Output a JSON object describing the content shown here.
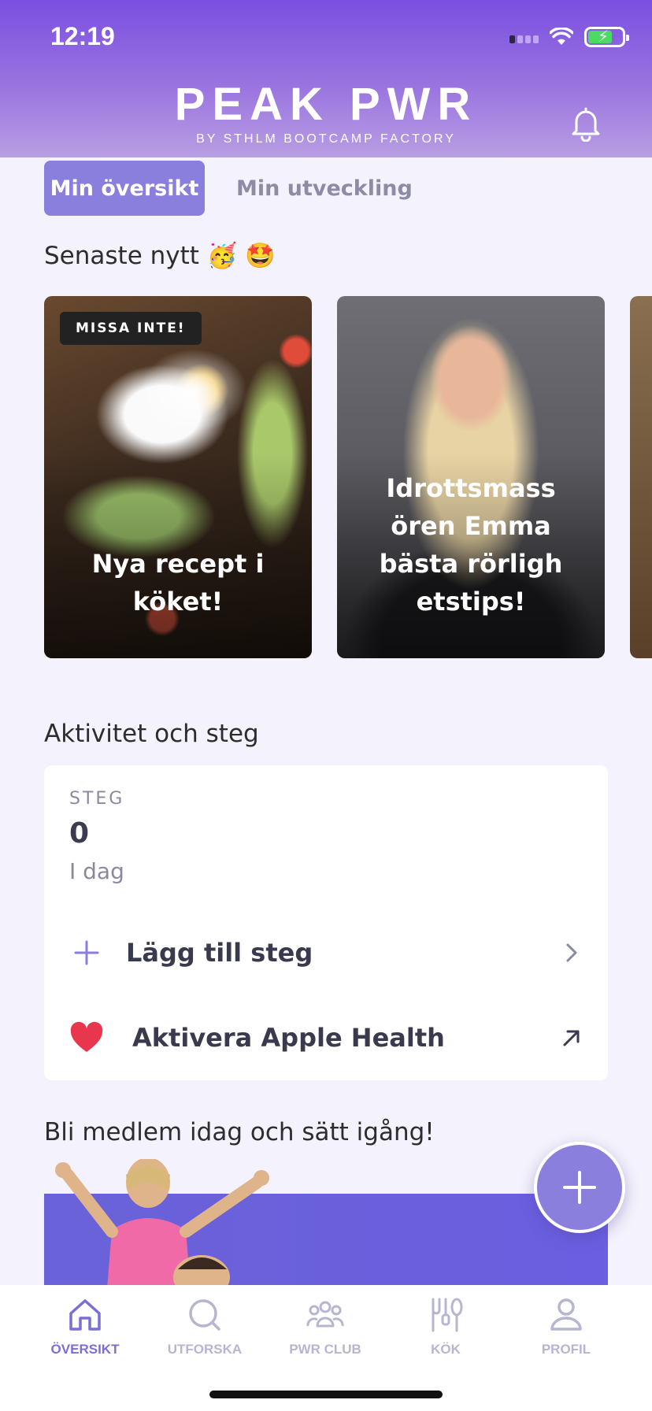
{
  "status_bar": {
    "time": "12:19"
  },
  "header": {
    "logo_main": "PEAK PWR",
    "logo_sub": "BY STHLM BOOTCAMP FACTORY",
    "bell_icon": "bell-icon"
  },
  "tabs": [
    {
      "label": "Min översikt",
      "active": true
    },
    {
      "label": "Min utveckling",
      "active": false
    }
  ],
  "news": {
    "title": "Senaste nytt 🥳 🤩",
    "cards": [
      {
        "badge": "MISSA INTE!",
        "title": "Nya recept i köket!"
      },
      {
        "title": "Idrottsmass ören Emma bästa rörligh etstips!"
      }
    ]
  },
  "activity": {
    "title": "Aktivitet och steg",
    "steps_label": "STEG",
    "steps_value": "0",
    "steps_period": "I dag",
    "add_steps": "Lägg till steg",
    "apple_health": "Aktivera Apple Health"
  },
  "member": {
    "title": "Bli medlem idag och sätt igång!"
  },
  "colors": {
    "accent": "#8a7fdc",
    "header_top": "#7a4fe0",
    "nav_active": "#7a6fd6",
    "heart": "#e8364f"
  },
  "bottom_nav": [
    {
      "label": "ÖVERSIKT",
      "icon": "home-icon",
      "active": true
    },
    {
      "label": "UTFORSKA",
      "icon": "search-icon",
      "active": false
    },
    {
      "label": "PWR CLUB",
      "icon": "group-icon",
      "active": false
    },
    {
      "label": "KÖK",
      "icon": "kitchen-utensils-icon",
      "active": false
    },
    {
      "label": "PROFIL",
      "icon": "profile-icon",
      "active": false
    }
  ]
}
